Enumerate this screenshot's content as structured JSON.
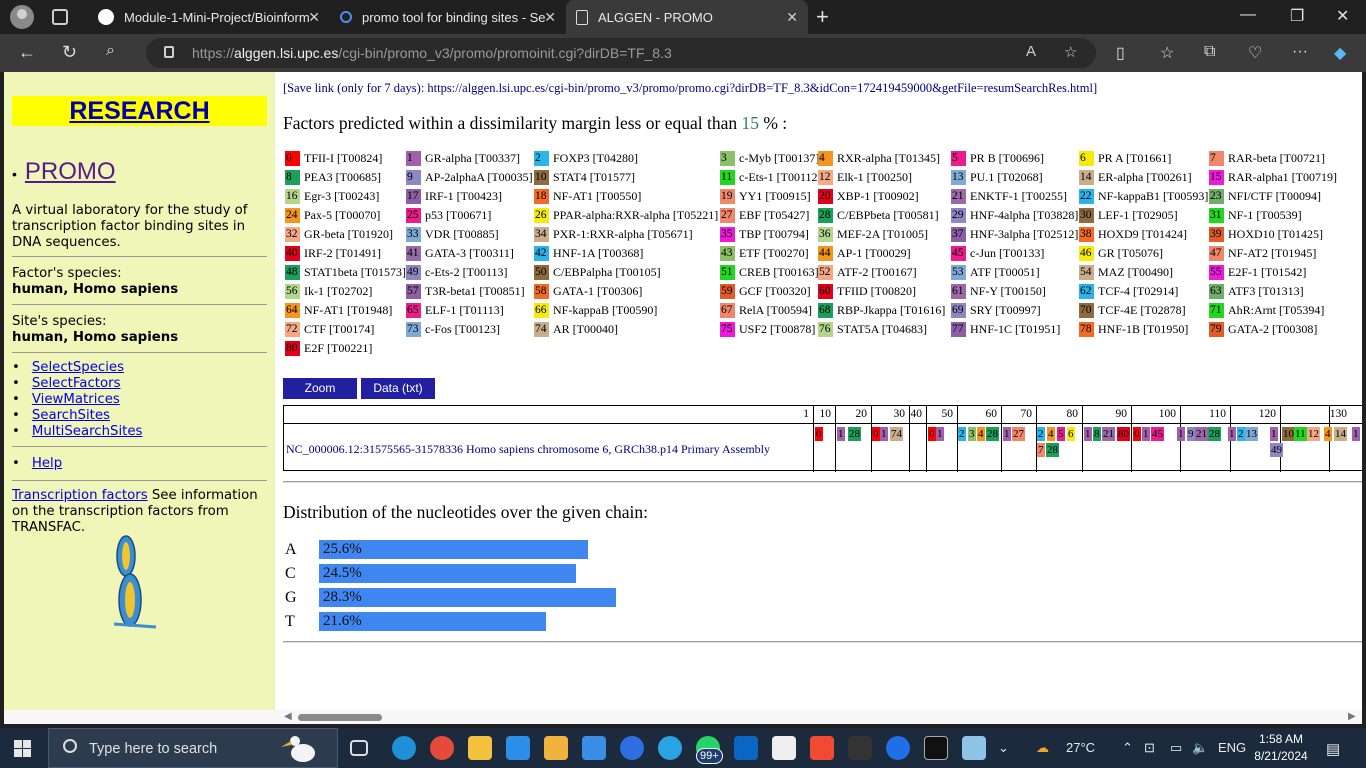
{
  "browser": {
    "tabs": [
      {
        "title": "Module-1-Mini-Project/Bioinform"
      },
      {
        "title": "promo tool for binding sites - Se"
      },
      {
        "title": "ALGGEN - PROMO"
      }
    ],
    "url_prefix": "https://",
    "url_host": "alggen.lsi.upc.es",
    "url_path": "/cgi-bin/promo_v3/promo/promoinit.cgi?dirDB=TF_8.3"
  },
  "sidebar": {
    "research": "RESEARCH",
    "promo": "PROMO",
    "description": "A virtual laboratory for the study of transcription factor binding sites in DNA sequences.",
    "factor_species_label": "Factor's species:",
    "factor_species_value": "human, Homo sapiens",
    "site_species_label": "Site's species:",
    "site_species_value": "human, Homo sapiens",
    "links": [
      "SelectSpecies",
      "SelectFactors",
      "ViewMatrices",
      "SearchSites",
      "MultiSearchSites"
    ],
    "help": "Help",
    "tf_link": "Transcription factors",
    "tf_text": " See information on the transcription factors from TRANSFAC."
  },
  "main": {
    "save_link": "[Save link (only for 7 days): https://alggen.lsi.upc.es/cgi-bin/promo_v3/promo/promo.cgi?dirDB=TF_8.3&idCon=172419459000&getFile=resumSearchRes.html]",
    "factors_title_pre": "Factors predicted within a dissimilarity margin less or equal than ",
    "factors_title_num": "15",
    "factors_title_post": " % :",
    "factors": [
      {
        "n": "0",
        "name": "TFII-I [T00824]",
        "color": "#ff0000"
      },
      {
        "n": "1",
        "name": "GR-alpha [T00337]",
        "color": "#a25fab"
      },
      {
        "n": "2",
        "name": "FOXP3 [T04280]",
        "color": "#29b6e8"
      },
      {
        "n": "3",
        "name": "c-Myb [T00137]",
        "color": "#8dc06a"
      },
      {
        "n": "4",
        "name": "RXR-alpha [T01345]",
        "color": "#f5941e"
      },
      {
        "n": "5",
        "name": "PR B [T00696]",
        "color": "#ec1c8c"
      },
      {
        "n": "6",
        "name": "PR A [T01661]",
        "color": "#f7eb0d"
      },
      {
        "n": "7",
        "name": "RAR-beta [T00721]",
        "color": "#f0876b"
      },
      {
        "n": "8",
        "name": "PEA3 [T00685]",
        "color": "#1aa05a"
      },
      {
        "n": "9",
        "name": "AP-2alphaA [T00035]",
        "color": "#8f86c4"
      },
      {
        "n": "10",
        "name": "STAT4 [T01577]",
        "color": "#8e6b3e"
      },
      {
        "n": "11",
        "name": "c-Ets-1 [T00112]",
        "color": "#22d81e"
      },
      {
        "n": "12",
        "name": "Elk-1 [T00250]",
        "color": "#f4a883"
      },
      {
        "n": "13",
        "name": "PU.1 [T02068]",
        "color": "#7fa9d6"
      },
      {
        "n": "14",
        "name": "ER-alpha [T00261]",
        "color": "#c9ad8c"
      },
      {
        "n": "15",
        "name": "RAR-alpha1 [T00719]",
        "color": "#ed1bd9"
      },
      {
        "n": "16",
        "name": "Egr-3 [T00243]",
        "color": "#b3d68c"
      },
      {
        "n": "17",
        "name": "IRF-1 [T00423]",
        "color": "#8b5fa6"
      },
      {
        "n": "18",
        "name": "NF-AT1 [T00550]",
        "color": "#f26a25"
      },
      {
        "n": "19",
        "name": "YY1 [T00915]",
        "color": "#f0876b"
      },
      {
        "n": "20",
        "name": "XBP-1 [T00902]",
        "color": "#e3001b"
      },
      {
        "n": "21",
        "name": "ENKTF-1 [T00255]",
        "color": "#9a6aa8"
      },
      {
        "n": "22",
        "name": "NF-kappaB1 [T00593]",
        "color": "#2ab3e8"
      },
      {
        "n": "23",
        "name": "NFI/CTF [T00094]",
        "color": "#6fae6a"
      },
      {
        "n": "24",
        "name": "Pax-5 [T00070]",
        "color": "#f5941e"
      },
      {
        "n": "25",
        "name": "p53 [T00671]",
        "color": "#ec1c8c"
      },
      {
        "n": "26",
        "name": "PPAR-alpha:RXR-alpha [T05221]",
        "color": "#f7eb0d"
      },
      {
        "n": "27",
        "name": "EBF [T05427]",
        "color": "#f0876b"
      },
      {
        "n": "28",
        "name": "C/EBPbeta [T00581]",
        "color": "#1aa05a"
      },
      {
        "n": "29",
        "name": "HNF-4alpha [T03828]",
        "color": "#8f86c4"
      },
      {
        "n": "30",
        "name": "LEF-1 [T02905]",
        "color": "#8e6b3e"
      },
      {
        "n": "31",
        "name": "NF-1 [T00539]",
        "color": "#22d81e"
      },
      {
        "n": "32",
        "name": "GR-beta [T01920]",
        "color": "#f4a883"
      },
      {
        "n": "33",
        "name": "VDR [T00885]",
        "color": "#7fa9d6"
      },
      {
        "n": "34",
        "name": "PXR-1:RXR-alpha [T05671]",
        "color": "#c9ad8c"
      },
      {
        "n": "35",
        "name": "TBP [T00794]",
        "color": "#ed1bd9"
      },
      {
        "n": "36",
        "name": "MEF-2A [T01005]",
        "color": "#b3d68c"
      },
      {
        "n": "37",
        "name": "HNF-3alpha [T02512]",
        "color": "#8b5fa6"
      },
      {
        "n": "38",
        "name": "HOXD9 [T01424]",
        "color": "#f26a25"
      },
      {
        "n": "39",
        "name": "HOXD10 [T01425]",
        "color": "#e05a2a"
      },
      {
        "n": "40",
        "name": "IRF-2 [T01491]",
        "color": "#e3001b"
      },
      {
        "n": "41",
        "name": "GATA-3 [T00311]",
        "color": "#9a6aa8"
      },
      {
        "n": "42",
        "name": "HNF-1A [T00368]",
        "color": "#2ab3e8"
      },
      {
        "n": "43",
        "name": "ETF [T00270]",
        "color": "#8dc06a"
      },
      {
        "n": "44",
        "name": "AP-1 [T00029]",
        "color": "#f5941e"
      },
      {
        "n": "45",
        "name": "c-Jun [T00133]",
        "color": "#ec1c8c"
      },
      {
        "n": "46",
        "name": "GR [T05076]",
        "color": "#f7eb0d"
      },
      {
        "n": "47",
        "name": "NF-AT2 [T01945]",
        "color": "#f0876b"
      },
      {
        "n": "48",
        "name": "STAT1beta [T01573]",
        "color": "#1aa05a"
      },
      {
        "n": "49",
        "name": "c-Ets-2 [T00113]",
        "color": "#8f86c4"
      },
      {
        "n": "50",
        "name": "C/EBPalpha [T00105]",
        "color": "#8e6b3e"
      },
      {
        "n": "51",
        "name": "CREB [T00163]",
        "color": "#22d81e"
      },
      {
        "n": "52",
        "name": "ATF-2 [T00167]",
        "color": "#f4a883"
      },
      {
        "n": "53",
        "name": "ATF [T00051]",
        "color": "#7fa9d6"
      },
      {
        "n": "54",
        "name": "MAZ [T00490]",
        "color": "#c9ad8c"
      },
      {
        "n": "55",
        "name": "E2F-1 [T01542]",
        "color": "#ed1bd9"
      },
      {
        "n": "56",
        "name": "Ik-1 [T02702]",
        "color": "#b3d68c"
      },
      {
        "n": "57",
        "name": "T3R-beta1 [T00851]",
        "color": "#8b5fa6"
      },
      {
        "n": "58",
        "name": "GATA-1 [T00306]",
        "color": "#f26a25"
      },
      {
        "n": "59",
        "name": "GCF [T00320]",
        "color": "#e05a2a"
      },
      {
        "n": "60",
        "name": "TFIID [T00820]",
        "color": "#e3001b"
      },
      {
        "n": "61",
        "name": "NF-Y [T00150]",
        "color": "#9a6aa8"
      },
      {
        "n": "62",
        "name": "TCF-4 [T02914]",
        "color": "#2ab3e8"
      },
      {
        "n": "63",
        "name": "ATF3 [T01313]",
        "color": "#6fae6a"
      },
      {
        "n": "64",
        "name": "NF-AT1 [T01948]",
        "color": "#f5941e"
      },
      {
        "n": "65",
        "name": "ELF-1 [T01113]",
        "color": "#ec1c8c"
      },
      {
        "n": "66",
        "name": "NF-kappaB [T00590]",
        "color": "#f7eb0d"
      },
      {
        "n": "67",
        "name": "RelA [T00594]",
        "color": "#f0876b"
      },
      {
        "n": "68",
        "name": "RBP-Jkappa [T01616]",
        "color": "#1aa05a"
      },
      {
        "n": "69",
        "name": "SRY [T00997]",
        "color": "#8f86c4"
      },
      {
        "n": "70",
        "name": "TCF-4E [T02878]",
        "color": "#8e6b3e"
      },
      {
        "n": "71",
        "name": "AhR:Arnt [T05394]",
        "color": "#22d81e"
      },
      {
        "n": "72",
        "name": "CTF [T00174]",
        "color": "#f4a883"
      },
      {
        "n": "73",
        "name": "c-Fos [T00123]",
        "color": "#7fa9d6"
      },
      {
        "n": "74",
        "name": "AR [T00040]",
        "color": "#c9ad8c"
      },
      {
        "n": "75",
        "name": "USF2 [T00878]",
        "color": "#ed1bd9"
      },
      {
        "n": "76",
        "name": "STAT5A [T04683]",
        "color": "#b3d68c"
      },
      {
        "n": "77",
        "name": "HNF-1C [T01951]",
        "color": "#8b5fa6"
      },
      {
        "n": "78",
        "name": "HNF-1B [T01950]",
        "color": "#f26a25"
      },
      {
        "n": "79",
        "name": "GATA-2 [T00308]",
        "color": "#e05a2a"
      },
      {
        "n": "80",
        "name": "E2F [T00221]",
        "color": "#e3001b"
      }
    ],
    "zoom_label": "Zoom",
    "data_label": "Data (txt)",
    "scale_ticks": [
      "1",
      "10",
      "20",
      "30",
      "40",
      "50",
      "60",
      "70",
      "80",
      "90",
      "100",
      "110",
      "120",
      "130"
    ],
    "sequence_name": "NC_000006.12:31575565-31578336 Homo sapiens chromosome 6, GRCh38.p14 Primary Assembly",
    "site_marks": [
      "0",
      "1",
      "28",
      "0",
      "1",
      "74",
      "0",
      "1",
      "2",
      "3",
      "4",
      "28",
      "1",
      "27",
      "2",
      "4",
      "5",
      "6",
      "7",
      "28",
      "1",
      "8",
      "21",
      "80",
      "0",
      "1",
      "45",
      "1",
      "9",
      "21",
      "28",
      "1",
      "2",
      "13",
      "1",
      "10",
      "11",
      "12",
      "49",
      "4",
      "14",
      "1"
    ],
    "dist_title": "Distribution of the nucleotides over the given chain:",
    "nucleotides": [
      {
        "base": "A",
        "pct": "25.6%",
        "value": 25.6
      },
      {
        "base": "C",
        "pct": "24.5%",
        "value": 24.5
      },
      {
        "base": "G",
        "pct": "28.3%",
        "value": 28.3
      },
      {
        "base": "T",
        "pct": "21.6%",
        "value": 21.6
      }
    ],
    "bar_color": "#3f86f0"
  },
  "taskbar": {
    "search_placeholder": "Type here to search",
    "badge": "99+",
    "weather": "27°C",
    "lang": "ENG",
    "time": "1:58 AM",
    "date": "8/21/2024",
    "notif_count": "1"
  }
}
